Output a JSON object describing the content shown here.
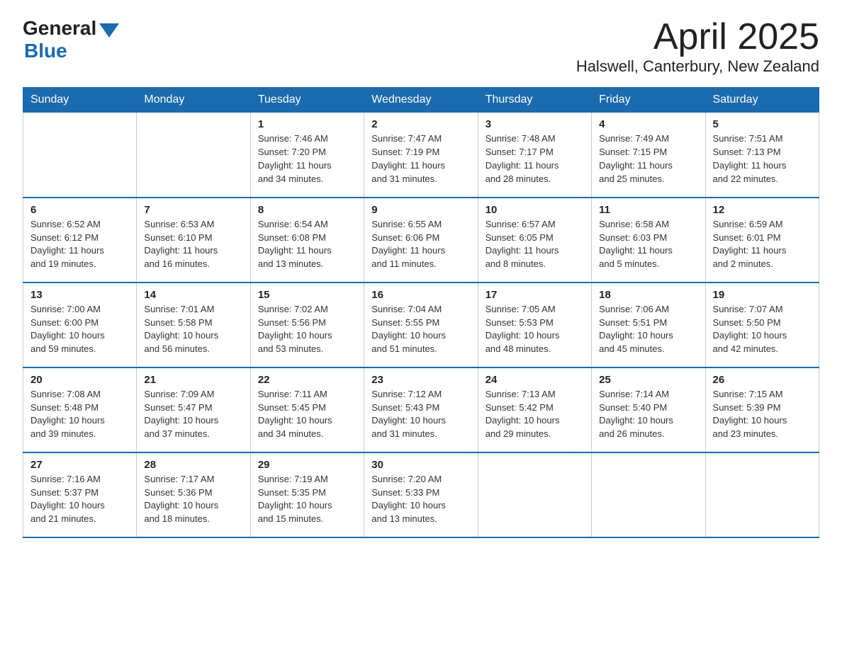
{
  "header": {
    "logo_general": "General",
    "logo_blue": "Blue",
    "title": "April 2025",
    "location": "Halswell, Canterbury, New Zealand"
  },
  "weekdays": [
    "Sunday",
    "Monday",
    "Tuesday",
    "Wednesday",
    "Thursday",
    "Friday",
    "Saturday"
  ],
  "weeks": [
    [
      {
        "day": "",
        "info": ""
      },
      {
        "day": "",
        "info": ""
      },
      {
        "day": "1",
        "info": "Sunrise: 7:46 AM\nSunset: 7:20 PM\nDaylight: 11 hours\nand 34 minutes."
      },
      {
        "day": "2",
        "info": "Sunrise: 7:47 AM\nSunset: 7:19 PM\nDaylight: 11 hours\nand 31 minutes."
      },
      {
        "day": "3",
        "info": "Sunrise: 7:48 AM\nSunset: 7:17 PM\nDaylight: 11 hours\nand 28 minutes."
      },
      {
        "day": "4",
        "info": "Sunrise: 7:49 AM\nSunset: 7:15 PM\nDaylight: 11 hours\nand 25 minutes."
      },
      {
        "day": "5",
        "info": "Sunrise: 7:51 AM\nSunset: 7:13 PM\nDaylight: 11 hours\nand 22 minutes."
      }
    ],
    [
      {
        "day": "6",
        "info": "Sunrise: 6:52 AM\nSunset: 6:12 PM\nDaylight: 11 hours\nand 19 minutes."
      },
      {
        "day": "7",
        "info": "Sunrise: 6:53 AM\nSunset: 6:10 PM\nDaylight: 11 hours\nand 16 minutes."
      },
      {
        "day": "8",
        "info": "Sunrise: 6:54 AM\nSunset: 6:08 PM\nDaylight: 11 hours\nand 13 minutes."
      },
      {
        "day": "9",
        "info": "Sunrise: 6:55 AM\nSunset: 6:06 PM\nDaylight: 11 hours\nand 11 minutes."
      },
      {
        "day": "10",
        "info": "Sunrise: 6:57 AM\nSunset: 6:05 PM\nDaylight: 11 hours\nand 8 minutes."
      },
      {
        "day": "11",
        "info": "Sunrise: 6:58 AM\nSunset: 6:03 PM\nDaylight: 11 hours\nand 5 minutes."
      },
      {
        "day": "12",
        "info": "Sunrise: 6:59 AM\nSunset: 6:01 PM\nDaylight: 11 hours\nand 2 minutes."
      }
    ],
    [
      {
        "day": "13",
        "info": "Sunrise: 7:00 AM\nSunset: 6:00 PM\nDaylight: 10 hours\nand 59 minutes."
      },
      {
        "day": "14",
        "info": "Sunrise: 7:01 AM\nSunset: 5:58 PM\nDaylight: 10 hours\nand 56 minutes."
      },
      {
        "day": "15",
        "info": "Sunrise: 7:02 AM\nSunset: 5:56 PM\nDaylight: 10 hours\nand 53 minutes."
      },
      {
        "day": "16",
        "info": "Sunrise: 7:04 AM\nSunset: 5:55 PM\nDaylight: 10 hours\nand 51 minutes."
      },
      {
        "day": "17",
        "info": "Sunrise: 7:05 AM\nSunset: 5:53 PM\nDaylight: 10 hours\nand 48 minutes."
      },
      {
        "day": "18",
        "info": "Sunrise: 7:06 AM\nSunset: 5:51 PM\nDaylight: 10 hours\nand 45 minutes."
      },
      {
        "day": "19",
        "info": "Sunrise: 7:07 AM\nSunset: 5:50 PM\nDaylight: 10 hours\nand 42 minutes."
      }
    ],
    [
      {
        "day": "20",
        "info": "Sunrise: 7:08 AM\nSunset: 5:48 PM\nDaylight: 10 hours\nand 39 minutes."
      },
      {
        "day": "21",
        "info": "Sunrise: 7:09 AM\nSunset: 5:47 PM\nDaylight: 10 hours\nand 37 minutes."
      },
      {
        "day": "22",
        "info": "Sunrise: 7:11 AM\nSunset: 5:45 PM\nDaylight: 10 hours\nand 34 minutes."
      },
      {
        "day": "23",
        "info": "Sunrise: 7:12 AM\nSunset: 5:43 PM\nDaylight: 10 hours\nand 31 minutes."
      },
      {
        "day": "24",
        "info": "Sunrise: 7:13 AM\nSunset: 5:42 PM\nDaylight: 10 hours\nand 29 minutes."
      },
      {
        "day": "25",
        "info": "Sunrise: 7:14 AM\nSunset: 5:40 PM\nDaylight: 10 hours\nand 26 minutes."
      },
      {
        "day": "26",
        "info": "Sunrise: 7:15 AM\nSunset: 5:39 PM\nDaylight: 10 hours\nand 23 minutes."
      }
    ],
    [
      {
        "day": "27",
        "info": "Sunrise: 7:16 AM\nSunset: 5:37 PM\nDaylight: 10 hours\nand 21 minutes."
      },
      {
        "day": "28",
        "info": "Sunrise: 7:17 AM\nSunset: 5:36 PM\nDaylight: 10 hours\nand 18 minutes."
      },
      {
        "day": "29",
        "info": "Sunrise: 7:19 AM\nSunset: 5:35 PM\nDaylight: 10 hours\nand 15 minutes."
      },
      {
        "day": "30",
        "info": "Sunrise: 7:20 AM\nSunset: 5:33 PM\nDaylight: 10 hours\nand 13 minutes."
      },
      {
        "day": "",
        "info": ""
      },
      {
        "day": "",
        "info": ""
      },
      {
        "day": "",
        "info": ""
      }
    ]
  ]
}
